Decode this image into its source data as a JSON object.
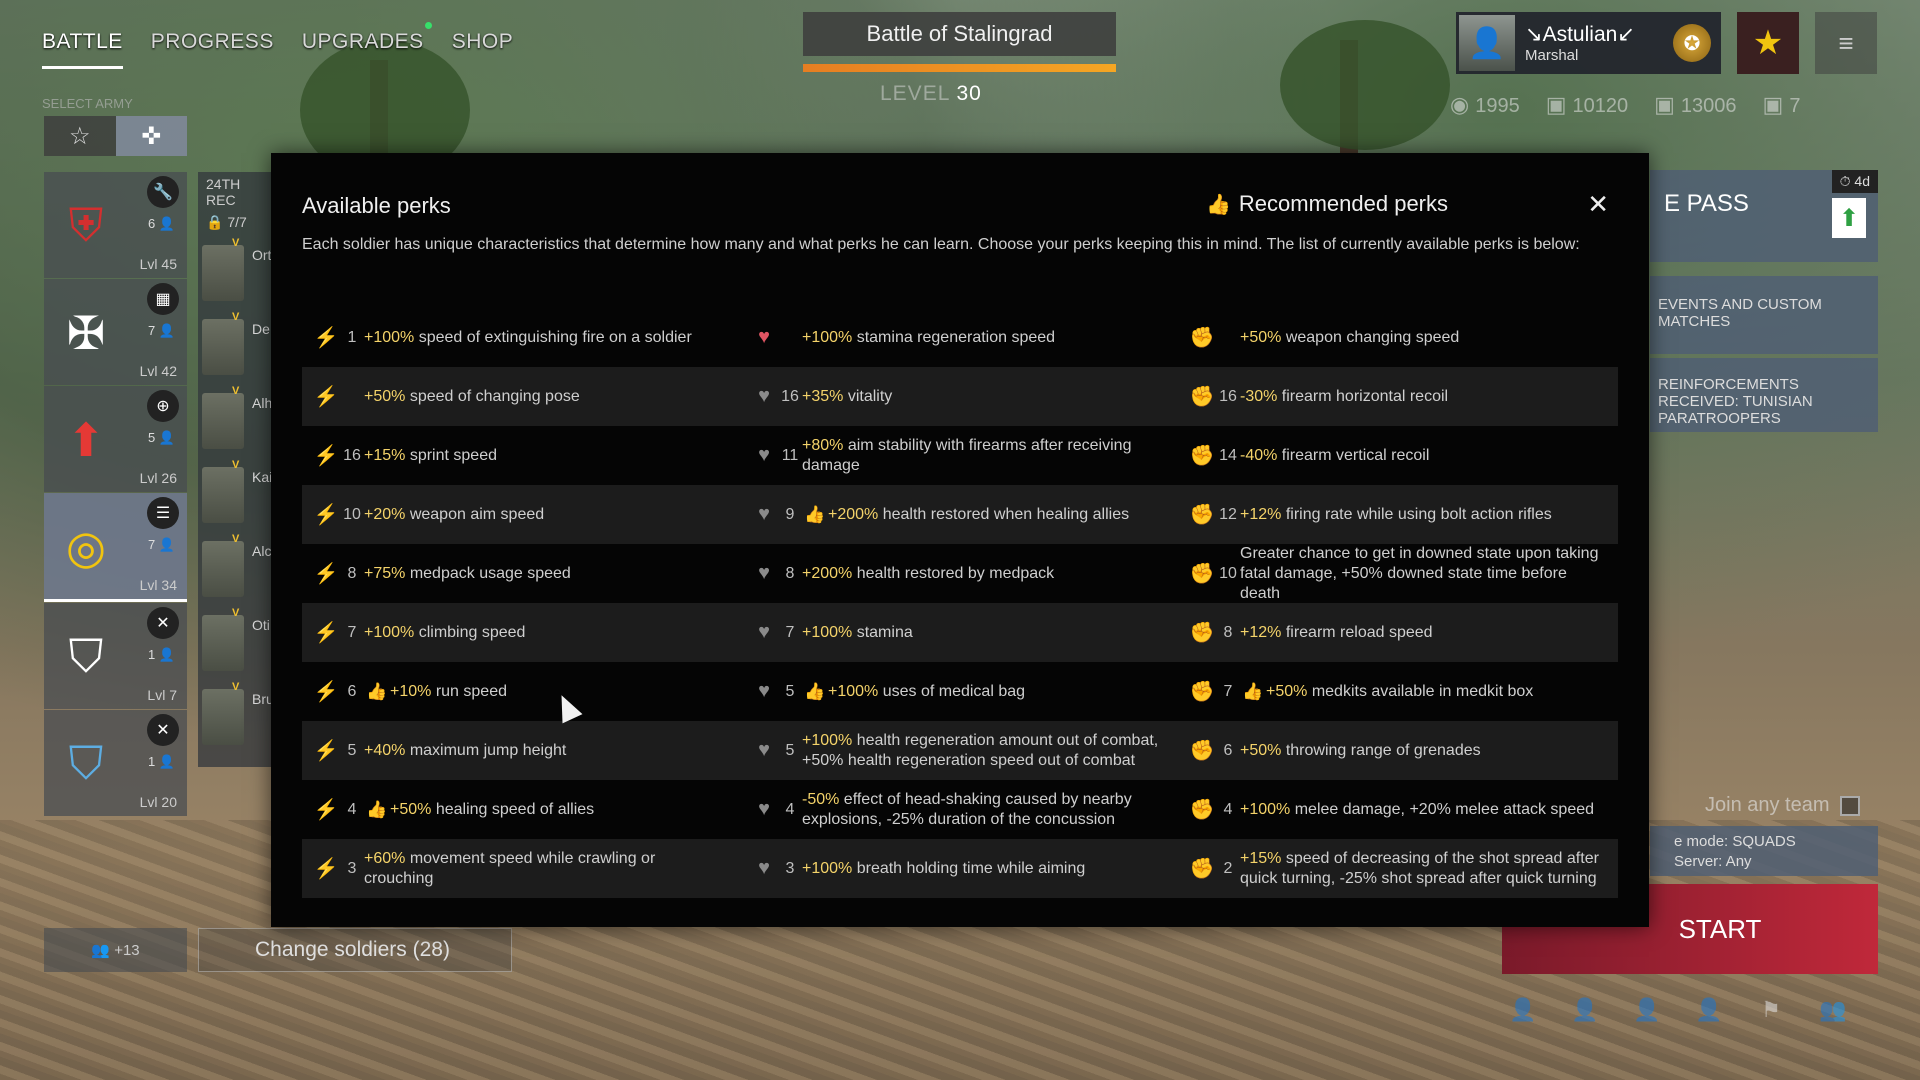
{
  "nav": {
    "items": [
      "BATTLE",
      "PROGRESS",
      "UPGRADES",
      "SHOP"
    ],
    "select_army": "SELECT ARMY"
  },
  "squads": [
    {
      "icon": "🔧",
      "count": "6",
      "level": "Lvl 45",
      "emblem": "⛨",
      "color": "#d32f2f"
    },
    {
      "icon": "▦",
      "count": "7",
      "level": "Lvl 42",
      "emblem": "✠",
      "color": "#ffffff"
    },
    {
      "icon": "⊕",
      "count": "5",
      "level": "Lvl 26",
      "emblem": "⬆",
      "color": "#e53935"
    },
    {
      "icon": "☰",
      "count": "7",
      "level": "Lvl 34",
      "emblem": "◎",
      "color": "#f1c40f"
    },
    {
      "icon": "✕",
      "count": "1",
      "level": "Lvl 7",
      "emblem": "⛉",
      "color": "#ffffff"
    },
    {
      "icon": "✕",
      "count": "1",
      "level": "Lvl 20",
      "emblem": "⛉",
      "color": "#5dade2"
    }
  ],
  "regiment": {
    "header": "24TH REC",
    "count": "7/7",
    "soldiers": [
      "Ort",
      "De",
      "Alh",
      "Kai",
      "Alc",
      "Oti",
      "Bru"
    ]
  },
  "bottom_left": {
    "label": "+13",
    "change_soldiers": "Change soldiers (28)"
  },
  "battle": {
    "title": "Battle of Stalingrad",
    "level_label": "LEVEL",
    "level_value": "30",
    "progress_percent": 100
  },
  "profile": {
    "name": "↘Astulian↙",
    "rank": "Marshal"
  },
  "currencies": [
    {
      "icon": "◉",
      "value": "1995"
    },
    {
      "icon": "▣",
      "value": "10120"
    },
    {
      "icon": "▣",
      "value": "13006"
    },
    {
      "icon": "▣",
      "value": "7"
    }
  ],
  "right_panel": {
    "pass_title": "E PASS",
    "pass_timer": "4d",
    "events": "EVENTS AND CUSTOM MATCHES",
    "reinforcements": "REINFORCEMENTS RECEIVED: TUNISIAN PARATROOPERS",
    "join_team": "Join any team",
    "mode": "e mode: SQUADS",
    "server": "Server: Any",
    "start": "START"
  },
  "modal": {
    "title": "Available perks",
    "recommended": "Recommended perks",
    "close": "✕",
    "description": "Each soldier has unique characteristics that determine how many and what perks he can learn. Choose your perks keeping this in mind. The list of currently available perks is below:",
    "columns": [
      {
        "icon": "runner",
        "perks": [
          {
            "num": "1",
            "thumb": false,
            "hl": "+100%",
            "text": " speed of extinguishing fire on a soldier",
            "icon_color": "green"
          },
          {
            "num": "",
            "thumb": false,
            "hl": "+50%",
            "text": " speed of changing pose",
            "icon_color": "green"
          },
          {
            "num": "16",
            "thumb": false,
            "hl": "+15%",
            "text": " sprint speed",
            "icon_color": "grey"
          },
          {
            "num": "10",
            "thumb": false,
            "hl": "+20%",
            "text": " weapon aim speed",
            "icon_color": "grey"
          },
          {
            "num": "8",
            "thumb": false,
            "hl": "+75%",
            "text": " medpack usage speed",
            "icon_color": "grey"
          },
          {
            "num": "7",
            "thumb": false,
            "hl": "+100%",
            "text": " climbing speed",
            "icon_color": "grey"
          },
          {
            "num": "6",
            "thumb": true,
            "hl": "+10%",
            "text": " run speed",
            "icon_color": "grey"
          },
          {
            "num": "5",
            "thumb": false,
            "hl": "+40%",
            "text": " maximum jump height",
            "icon_color": "grey"
          },
          {
            "num": "4",
            "thumb": true,
            "hl": "+50%",
            "text": " healing speed of allies",
            "icon_color": "grey"
          },
          {
            "num": "3",
            "thumb": false,
            "hl": "+60%",
            "text": " movement speed while crawling or crouching",
            "icon_color": "grey"
          }
        ]
      },
      {
        "icon": "heart",
        "perks": [
          {
            "num": "",
            "thumb": false,
            "hl": "+100%",
            "text": " stamina regeneration speed",
            "icon_color": "red"
          },
          {
            "num": "16",
            "thumb": false,
            "hl": "+35%",
            "text": " vitality",
            "icon_color": "grey"
          },
          {
            "num": "11",
            "thumb": false,
            "hl": "+80%",
            "text": " aim stability with firearms after receiving damage",
            "icon_color": "grey"
          },
          {
            "num": "9",
            "thumb": true,
            "hl": "+200%",
            "text": " health restored when healing allies",
            "icon_color": "grey"
          },
          {
            "num": "8",
            "thumb": false,
            "hl": "+200%",
            "text": " health restored by medpack",
            "icon_color": "grey"
          },
          {
            "num": "7",
            "thumb": false,
            "hl": "+100%",
            "text": " stamina",
            "icon_color": "grey"
          },
          {
            "num": "5",
            "thumb": true,
            "hl": "+100%",
            "text": " uses of medical bag",
            "icon_color": "grey"
          },
          {
            "num": "5",
            "thumb": false,
            "hl": "+100%",
            "text": " health regeneration amount out of combat, +50% health regeneration speed out of combat",
            "icon_color": "grey"
          },
          {
            "num": "4",
            "thumb": false,
            "hl": "-50%",
            "text": " effect of head-shaking caused by nearby explosions, -25% duration of the concussion",
            "icon_color": "grey"
          },
          {
            "num": "3",
            "thumb": false,
            "hl": "+100%",
            "text": " breath holding time while aiming",
            "icon_color": "grey"
          }
        ]
      },
      {
        "icon": "fist",
        "perks": [
          {
            "num": "",
            "thumb": false,
            "hl": "+50%",
            "text": " weapon changing speed",
            "icon_color": "yellow"
          },
          {
            "num": "16",
            "thumb": false,
            "hl": "-30%",
            "text": " firearm horizontal recoil",
            "icon_color": "grey"
          },
          {
            "num": "14",
            "thumb": false,
            "hl": "-40%",
            "text": " firearm vertical recoil",
            "icon_color": "grey"
          },
          {
            "num": "12",
            "thumb": false,
            "hl": "+12%",
            "text": " firing rate while using bolt action rifles",
            "icon_color": "grey"
          },
          {
            "num": "10",
            "thumb": false,
            "hl": "",
            "text": "Greater chance to get in downed state upon taking fatal damage, +50% downed state time before death",
            "icon_color": "grey"
          },
          {
            "num": "8",
            "thumb": false,
            "hl": "+12%",
            "text": " firearm reload speed",
            "icon_color": "grey"
          },
          {
            "num": "7",
            "thumb": true,
            "hl": "+50%",
            "text": " medkits available in medkit box",
            "icon_color": "grey"
          },
          {
            "num": "6",
            "thumb": false,
            "hl": "+50%",
            "text": " throwing range of grenades",
            "icon_color": "grey"
          },
          {
            "num": "4",
            "thumb": false,
            "hl": "+100%",
            "text": " melee damage, +20% melee attack speed",
            "icon_color": "grey"
          },
          {
            "num": "2",
            "thumb": false,
            "hl": "+15%",
            "text": " speed of decreasing of the shot spread after quick turning, -25% shot spread after quick turning",
            "icon_color": "grey"
          }
        ]
      }
    ]
  }
}
